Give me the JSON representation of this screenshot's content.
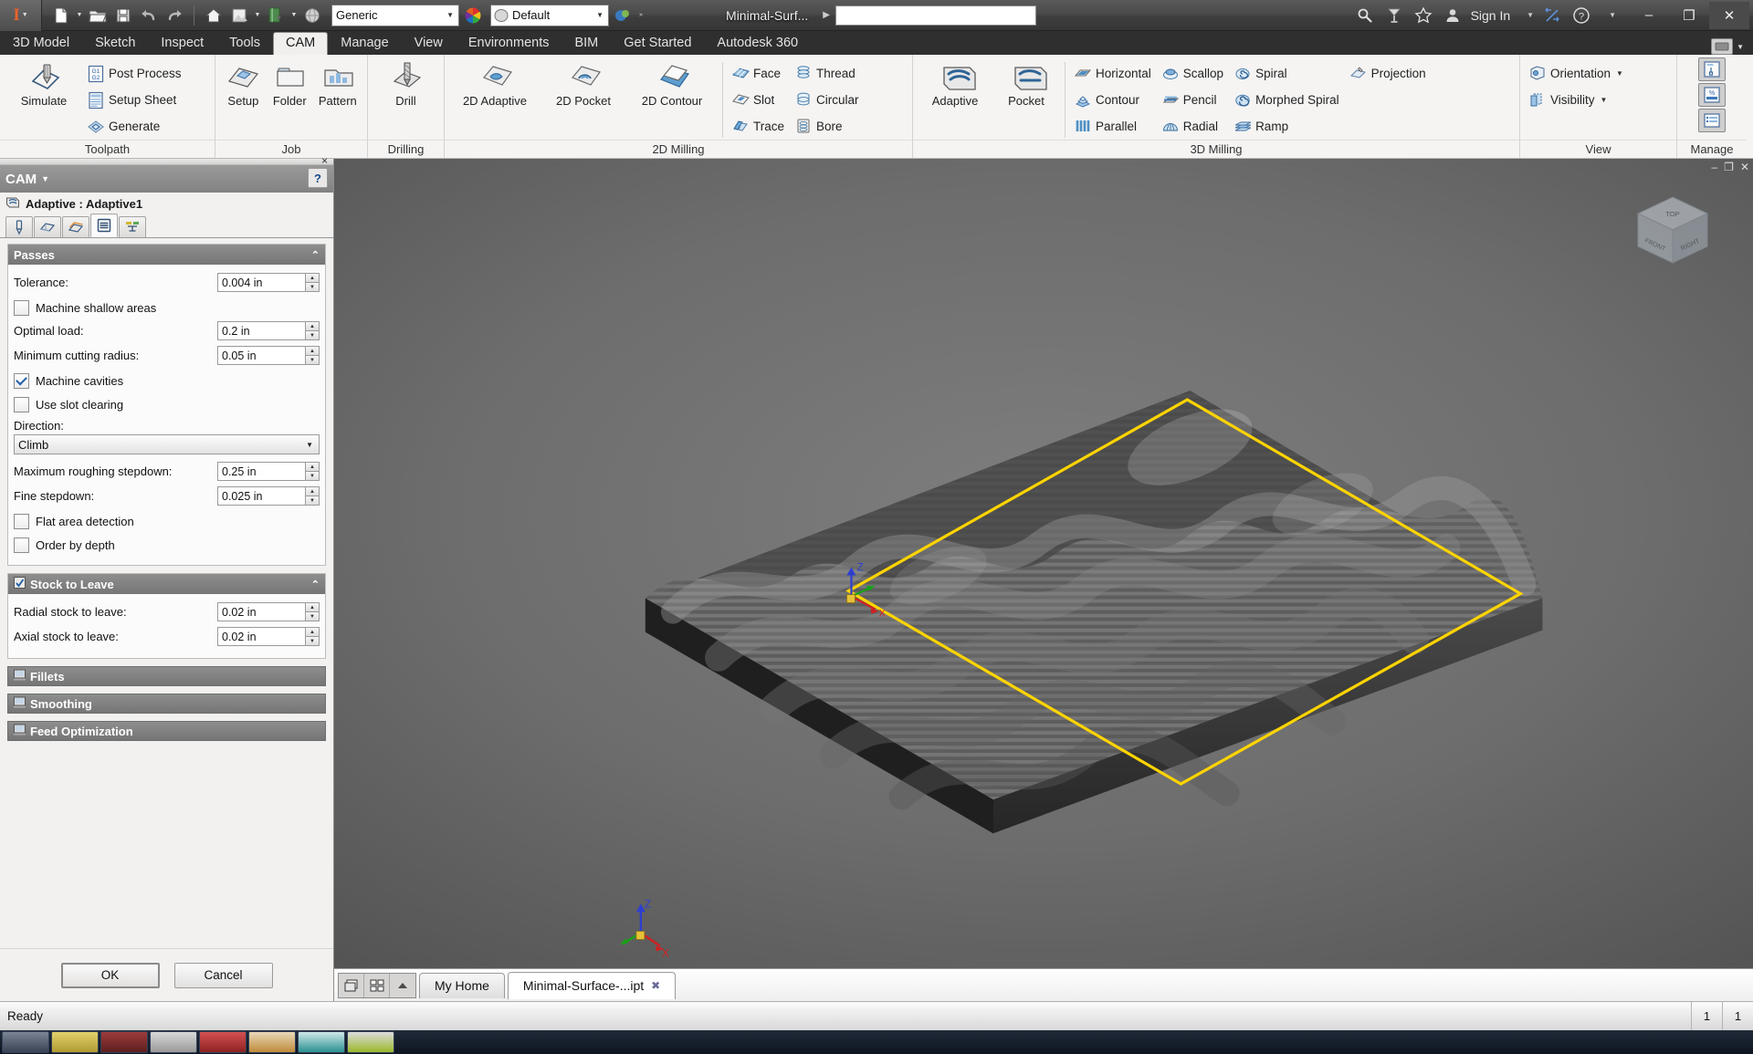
{
  "titlebar": {
    "app_icon": "inventor-logo-icon",
    "quick_access": [
      {
        "name": "new-file-icon",
        "glyph": "new"
      },
      {
        "name": "open-file-icon",
        "glyph": "open"
      },
      {
        "name": "save-icon",
        "glyph": "save"
      },
      {
        "name": "undo-icon",
        "glyph": "undo"
      },
      {
        "name": "redo-icon",
        "glyph": "redo"
      },
      {
        "name": "home-icon",
        "glyph": "home"
      },
      {
        "name": "appearance-icon",
        "glyph": "appearance"
      },
      {
        "name": "material-icon",
        "glyph": "material"
      },
      {
        "name": "sphere-icon",
        "glyph": "sphere"
      }
    ],
    "material_combo": "Generic",
    "appearance_combo": "Default",
    "document_title": "Minimal-Surf...",
    "search_placeholder": "",
    "search_value": "",
    "sign_in": "Sign In",
    "help_icon": "help-icon",
    "minimize": "–",
    "maximize": "❐",
    "close": "✕"
  },
  "ribbon_tabs": {
    "items": [
      {
        "label": "3D Model",
        "active": false
      },
      {
        "label": "Sketch",
        "active": false
      },
      {
        "label": "Inspect",
        "active": false
      },
      {
        "label": "Tools",
        "active": false
      },
      {
        "label": "CAM",
        "active": true
      },
      {
        "label": "Manage",
        "active": false
      },
      {
        "label": "View",
        "active": false
      },
      {
        "label": "Environments",
        "active": false
      },
      {
        "label": "BIM",
        "active": false
      },
      {
        "label": "Get Started",
        "active": false
      },
      {
        "label": "Autodesk 360",
        "active": false
      }
    ]
  },
  "ribbon": {
    "groups": [
      {
        "title": "Toolpath",
        "big": [
          {
            "label": "Simulate",
            "icon": "simulate-icon"
          }
        ],
        "small": [
          {
            "label": "Post Process",
            "icon": "post-process-icon"
          },
          {
            "label": "Setup Sheet",
            "icon": "setup-sheet-icon"
          },
          {
            "label": "Generate",
            "icon": "generate-icon"
          }
        ]
      },
      {
        "title": "Job",
        "big": [
          {
            "label": "Setup",
            "icon": "setup-icon"
          },
          {
            "label": "Folder",
            "icon": "folder-icon"
          },
          {
            "label": "Pattern",
            "icon": "pattern-icon"
          }
        ],
        "small": []
      },
      {
        "title": "Drilling",
        "big": [
          {
            "label": "Drill",
            "icon": "drill-icon"
          }
        ],
        "small": []
      },
      {
        "title": "2D Milling",
        "big": [
          {
            "label": "2D Adaptive",
            "icon": "2d-adaptive-icon"
          },
          {
            "label": "2D Pocket",
            "icon": "2d-pocket-icon"
          },
          {
            "label": "2D Contour",
            "icon": "2d-contour-icon"
          }
        ],
        "small": [
          {
            "label": "Face",
            "icon": "face-icon"
          },
          {
            "label": "Slot",
            "icon": "slot-icon"
          },
          {
            "label": "Trace",
            "icon": "trace-icon"
          }
        ],
        "small2": [
          {
            "label": "Thread",
            "icon": "thread-icon"
          },
          {
            "label": "Circular",
            "icon": "circular-icon"
          },
          {
            "label": "Bore",
            "icon": "bore-icon"
          }
        ]
      },
      {
        "title": "3D Milling",
        "big": [
          {
            "label": "Adaptive",
            "icon": "adaptive-icon"
          },
          {
            "label": "Pocket",
            "icon": "pocket-icon"
          }
        ],
        "small": [
          {
            "label": "Horizontal",
            "icon": "horizontal-icon"
          },
          {
            "label": "Contour",
            "icon": "contour-icon"
          },
          {
            "label": "Parallel",
            "icon": "parallel-icon"
          }
        ],
        "small2": [
          {
            "label": "Scallop",
            "icon": "scallop-icon"
          },
          {
            "label": "Pencil",
            "icon": "pencil-icon"
          },
          {
            "label": "Radial",
            "icon": "radial-icon"
          }
        ],
        "small3": [
          {
            "label": "Spiral",
            "icon": "spiral-icon"
          },
          {
            "label": "Morphed Spiral",
            "icon": "morphed-spiral-icon"
          },
          {
            "label": "Ramp",
            "icon": "ramp-icon"
          }
        ],
        "small4": [
          {
            "label": "Projection",
            "icon": "projection-icon"
          }
        ]
      },
      {
        "title": "View",
        "small": [
          {
            "label": "Orientation",
            "icon": "orientation-icon",
            "dropdown": true
          },
          {
            "label": "Visibility",
            "icon": "visibility-icon",
            "dropdown": true
          }
        ]
      },
      {
        "title": "Manage",
        "icons": [
          "tool-library-icon",
          "machine-percent-icon",
          "list-icon"
        ]
      }
    ]
  },
  "left_panel": {
    "header_title": "CAM",
    "help_label": "?",
    "operation_label": "Adaptive : Adaptive1",
    "operation_icon": "adaptive-operation-icon",
    "tabs": [
      {
        "name": "tool-tab",
        "icon": "tool-icon",
        "active": false
      },
      {
        "name": "geometry-tab",
        "icon": "geometry-icon",
        "active": false
      },
      {
        "name": "heights-tab",
        "icon": "heights-icon",
        "active": false
      },
      {
        "name": "passes-tab",
        "icon": "passes-icon",
        "active": true
      },
      {
        "name": "linking-tab",
        "icon": "linking-icon",
        "active": false
      }
    ],
    "sections": [
      {
        "id": "passes",
        "title": "Passes",
        "expanded": true,
        "fields": [
          {
            "type": "spin",
            "label": "Tolerance:",
            "value": "0.004 in"
          },
          {
            "type": "check",
            "label": "Machine shallow areas",
            "checked": false
          },
          {
            "type": "spin",
            "label": "Optimal load:",
            "value": "0.2 in"
          },
          {
            "type": "spin",
            "label": "Minimum cutting radius:",
            "value": "0.05 in"
          },
          {
            "type": "check",
            "label": "Machine cavities",
            "checked": true
          },
          {
            "type": "check",
            "label": "Use slot clearing",
            "checked": false
          },
          {
            "type": "selectlabel",
            "label": "Direction:"
          },
          {
            "type": "select",
            "value": "Climb"
          },
          {
            "type": "spin",
            "label": "Maximum roughing stepdown:",
            "value": "0.25 in"
          },
          {
            "type": "spin",
            "label": "Fine stepdown:",
            "value": "0.025 in"
          },
          {
            "type": "check",
            "label": "Flat area detection",
            "checked": false
          },
          {
            "type": "check",
            "label": "Order by depth",
            "checked": false
          }
        ]
      },
      {
        "id": "stock_to_leave",
        "title": "Stock to Leave",
        "expanded": true,
        "fields": [
          {
            "type": "spin",
            "label": "Radial stock to leave:",
            "value": "0.02 in"
          },
          {
            "type": "spin",
            "label": "Axial stock to leave:",
            "value": "0.02 in"
          }
        ]
      },
      {
        "id": "fillets",
        "title": "Fillets",
        "expanded": false,
        "fields": []
      },
      {
        "id": "smoothing",
        "title": "Smoothing",
        "expanded": false,
        "fields": []
      },
      {
        "id": "feed_optimization",
        "title": "Feed Optimization",
        "expanded": false,
        "fields": []
      }
    ],
    "ok_label": "OK",
    "cancel_label": "Cancel"
  },
  "viewport": {
    "window_controls": [
      "–",
      "❐",
      "✕"
    ],
    "viewcube_faces": {
      "top": "TOP",
      "front": "FRONT",
      "right": "RIGHT"
    },
    "axis_triad": {
      "x": "X",
      "y": "Y",
      "z": "Z"
    },
    "stock_boundary_color": "#ffd400",
    "model_name": "minimal-surface-mesh"
  },
  "doc_tabs": {
    "nav_icons": [
      "tile-windows-icon",
      "grid-windows-icon",
      "scroll-up-icon"
    ],
    "tabs": [
      {
        "label": "My Home",
        "active": false,
        "closable": false
      },
      {
        "label": "Minimal-Surface-...ipt",
        "active": true,
        "closable": true
      }
    ]
  },
  "statusbar": {
    "message": "Ready",
    "cells": [
      "1",
      "1"
    ]
  }
}
